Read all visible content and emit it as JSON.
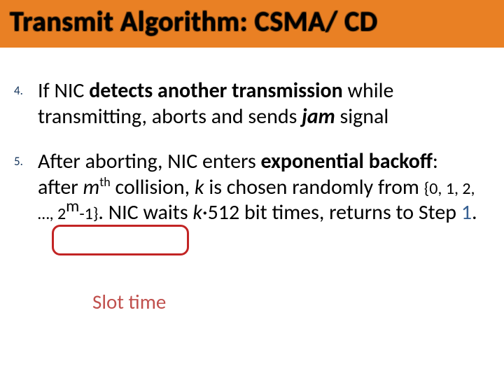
{
  "title": "Transmit Algorithm: CSMA/ CD",
  "items": [
    {
      "num": "4.",
      "parts": {
        "p0": "If NIC ",
        "p1": "detects another transmission",
        "p2": " while transmitting,  aborts and sends ",
        "p3": "jam",
        "p4": " signal"
      }
    },
    {
      "num": "5.",
      "parts": {
        "p0": "After aborting, NIC enters ",
        "p1": "exponential backoff",
        "p2": ": after ",
        "p3": "m",
        "p4": "th",
        "p5": " collision, ",
        "p6": "k",
        "p7": " is chosen randomly from ",
        "p8": "{0, 1, 2, …, 2",
        "p8sup": "m",
        "p8b": "-1}",
        "p9": ". NIC waits ",
        "p10": "k",
        "p11": "·512 bit times, returns to Step ",
        "p12": "1",
        "p13": "."
      }
    }
  ],
  "annotation": "Slot time"
}
